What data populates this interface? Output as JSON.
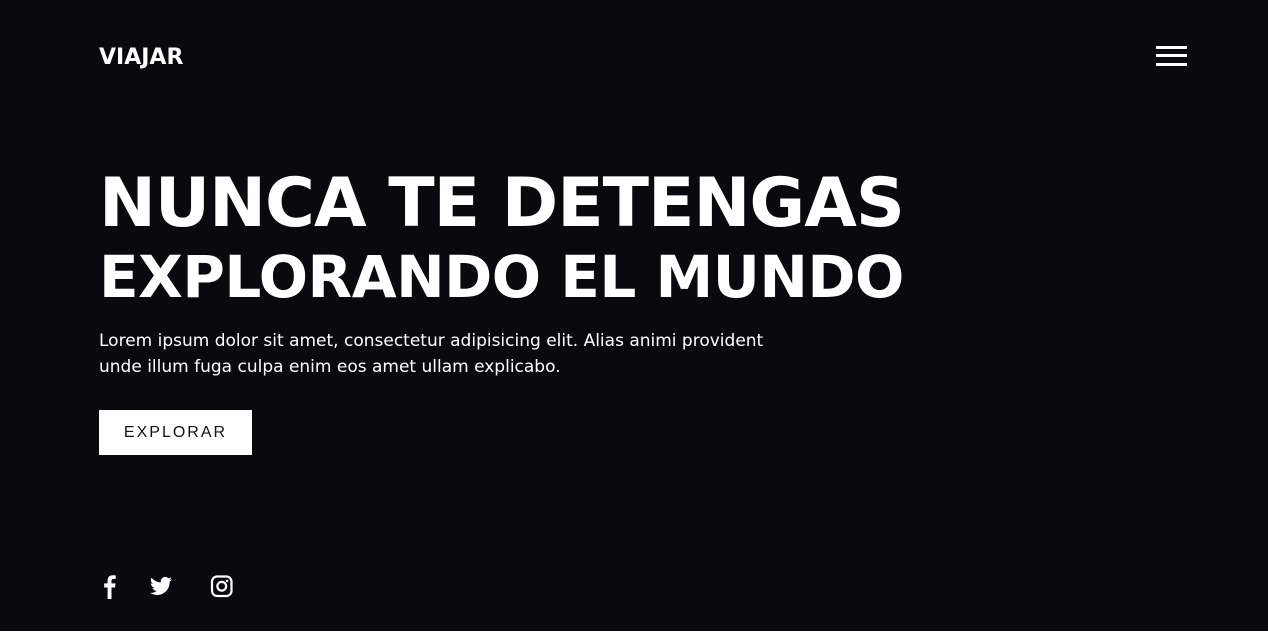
{
  "brand": {
    "logo_text": "VIAJAR"
  },
  "header": {
    "menu_icon": "hamburger-menu-icon"
  },
  "hero": {
    "title_line1": "NUNCA TE DETENGAS",
    "title_line2": "EXPLORANDO EL MUNDO",
    "description": "Lorem ipsum dolor sit amet, consectetur adipisicing elit. Alias animi provident unde illum fuga culpa enim eos amet ullam explicabo.",
    "cta_label": "EXPLORAR"
  },
  "social": {
    "links": [
      {
        "icon": "facebook-icon"
      },
      {
        "icon": "twitter-icon"
      },
      {
        "icon": "instagram-icon"
      }
    ]
  },
  "colors": {
    "background": "#0a0a0e",
    "text": "#ffffff",
    "button_bg": "#ffffff",
    "button_text": "#111111"
  }
}
